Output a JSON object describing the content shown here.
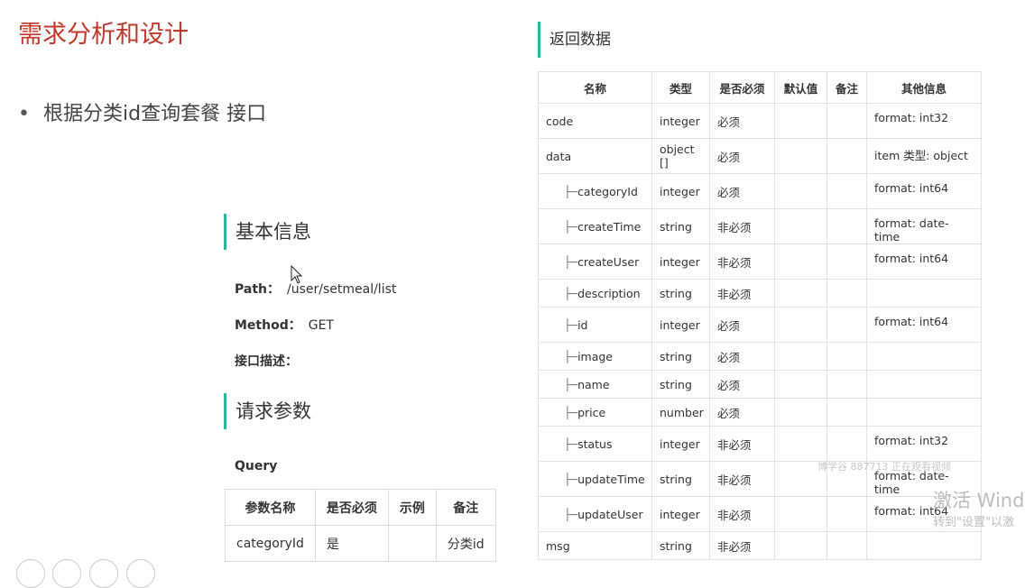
{
  "slide": {
    "title": "需求分析和设计",
    "bullet": "根据分类id查询套餐 接口"
  },
  "basic": {
    "heading": "基本信息",
    "path_label": "Path：",
    "path_value": "/user/setmeal/list",
    "method_label": "Method：",
    "method_value": "GET",
    "desc_label": "接口描述："
  },
  "request": {
    "heading": "请求参数",
    "query_label": "Query",
    "columns": [
      "参数名称",
      "是否必须",
      "示例",
      "备注"
    ],
    "rows": [
      [
        "categoryId",
        "是",
        "",
        "分类id"
      ]
    ]
  },
  "response": {
    "heading": "返回数据",
    "columns": [
      "名称",
      "类型",
      "是否必须",
      "默认值",
      "备注",
      "其他信息"
    ],
    "rows": [
      {
        "name": "code",
        "type": "integer",
        "required": "必须",
        "default": "",
        "note": "",
        "info": "format: int32",
        "child": false
      },
      {
        "name": "data",
        "type": "object []",
        "required": "必须",
        "default": "",
        "note": "",
        "info": "item 类型: object",
        "child": false
      },
      {
        "name": "categoryId",
        "type": "integer",
        "required": "必须",
        "default": "",
        "note": "",
        "info": "format: int64",
        "child": true
      },
      {
        "name": "createTime",
        "type": "string",
        "required": "非必须",
        "default": "",
        "note": "",
        "info": "format: date-time",
        "child": true
      },
      {
        "name": "createUser",
        "type": "integer",
        "required": "非必须",
        "default": "",
        "note": "",
        "info": "format: int64",
        "child": true
      },
      {
        "name": "description",
        "type": "string",
        "required": "非必须",
        "default": "",
        "note": "",
        "info": "",
        "child": true
      },
      {
        "name": "id",
        "type": "integer",
        "required": "必须",
        "default": "",
        "note": "",
        "info": "format: int64",
        "child": true
      },
      {
        "name": "image",
        "type": "string",
        "required": "必须",
        "default": "",
        "note": "",
        "info": "",
        "child": true
      },
      {
        "name": "name",
        "type": "string",
        "required": "必须",
        "default": "",
        "note": "",
        "info": "",
        "child": true
      },
      {
        "name": "price",
        "type": "number",
        "required": "必须",
        "default": "",
        "note": "",
        "info": "",
        "child": true
      },
      {
        "name": "status",
        "type": "integer",
        "required": "非必须",
        "default": "",
        "note": "",
        "info": "format: int32",
        "child": true
      },
      {
        "name": "updateTime",
        "type": "string",
        "required": "非必须",
        "default": "",
        "note": "",
        "info": "format: date-time",
        "child": true
      },
      {
        "name": "updateUser",
        "type": "integer",
        "required": "非必须",
        "default": "",
        "note": "",
        "info": "format: int64",
        "child": true
      },
      {
        "name": "msg",
        "type": "string",
        "required": "非必须",
        "default": "",
        "note": "",
        "info": "",
        "child": false
      }
    ],
    "tree_prefix": "├─"
  },
  "overlay": {
    "watermark": "博学谷 887713 正在观看视频",
    "activate_line1": "激活 Windo",
    "activate_line2": "转到\"设置\"以激"
  },
  "colors": {
    "title": "#c0392b",
    "accent_bar": "#28b79a"
  }
}
